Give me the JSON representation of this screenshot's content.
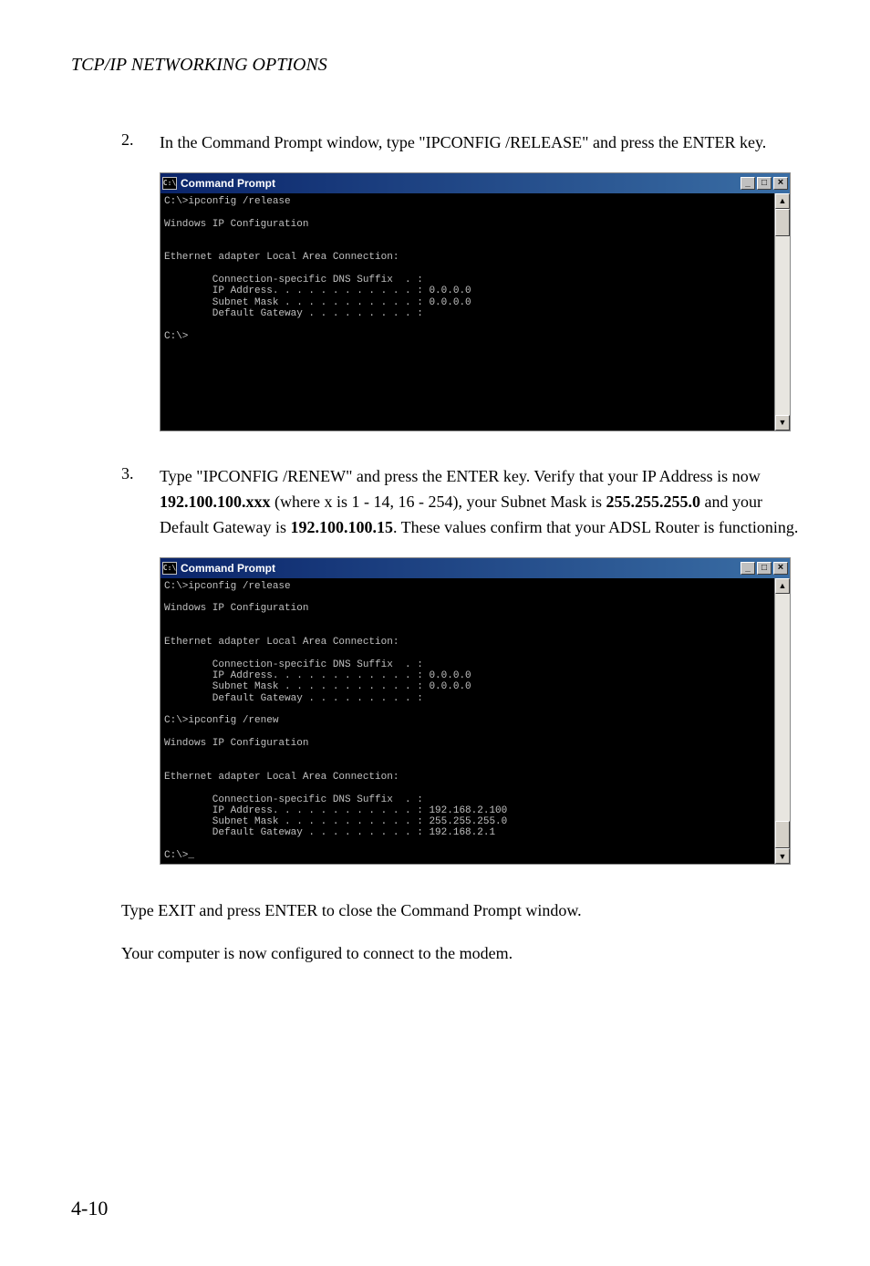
{
  "header": {
    "title_part1": "TCP/IP N",
    "title_part2": "ETWORKING",
    "title_part3": " O",
    "title_part4": "PTIONS"
  },
  "step2": {
    "number": "2.",
    "text": "In the Command Prompt window, type \"IPCONFIG /RELEASE\" and press the ENTER key."
  },
  "cmd1": {
    "title": "Command Prompt",
    "icon_text": "C:\\",
    "lines": "C:\\>ipconfig /release\n\nWindows IP Configuration\n\n\nEthernet adapter Local Area Connection:\n\n        Connection-specific DNS Suffix  . :\n        IP Address. . . . . . . . . . . . : 0.0.0.0\n        Subnet Mask . . . . . . . . . . . : 0.0.0.0\n        Default Gateway . . . . . . . . . :\n\nC:\\>\n\n\n\n\n\n\n\n"
  },
  "step3": {
    "number": "3.",
    "text_a": "Type \"IPCONFIG /RENEW\" and press the ENTER key. Verify that your IP Address is now ",
    "bold_ip": "192.100.100.xxx",
    "text_b": " (where x is 1 - 14, 16 - 254), your Subnet Mask is ",
    "bold_mask": "255.255.255.0",
    "text_c": " and your Default Gateway is ",
    "bold_gw": "192.100.100.15",
    "text_d": ". These values confirm that your ADSL Router is functioning."
  },
  "cmd2": {
    "title": "Command Prompt",
    "icon_text": "C:\\",
    "lines": "C:\\>ipconfig /release\n\nWindows IP Configuration\n\n\nEthernet adapter Local Area Connection:\n\n        Connection-specific DNS Suffix  . :\n        IP Address. . . . . . . . . . . . : 0.0.0.0\n        Subnet Mask . . . . . . . . . . . : 0.0.0.0\n        Default Gateway . . . . . . . . . :\n\nC:\\>ipconfig /renew\n\nWindows IP Configuration\n\n\nEthernet adapter Local Area Connection:\n\n        Connection-specific DNS Suffix  . :\n        IP Address. . . . . . . . . . . . : 192.168.2.100\n        Subnet Mask . . . . . . . . . . . : 255.255.255.0\n        Default Gateway . . . . . . . . . : 192.168.2.1\n\nC:\\>_"
  },
  "para_exit": "Type EXIT and press ENTER to close the Command Prompt window.",
  "para_done": "Your computer is now configured to connect to the modem.",
  "page_number": "4-10",
  "window_controls": {
    "minimize": "_",
    "maximize": "□",
    "close": "×",
    "scroll_up": "▲",
    "scroll_down": "▼"
  }
}
